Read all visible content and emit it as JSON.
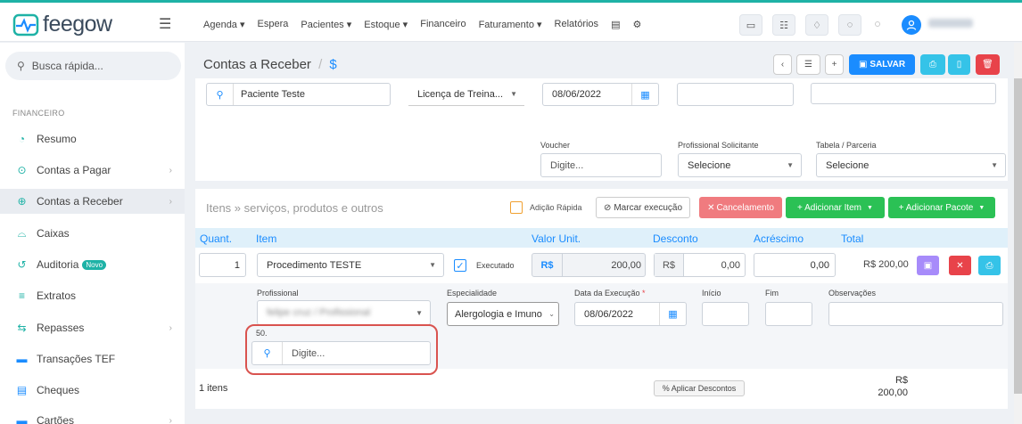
{
  "app": {
    "logo": "feegow",
    "user_name": "felipe cruz"
  },
  "topnav": {
    "items": [
      "Agenda ▾",
      "Espera",
      "Pacientes ▾",
      "Estoque ▾",
      "Financeiro",
      "Faturamento ▾",
      "Relatórios"
    ]
  },
  "sidebar": {
    "search_placeholder": "Busca rápida...",
    "section": "FINANCEIRO",
    "items": [
      {
        "label": "Resumo",
        "icon": "chart-pie-icon"
      },
      {
        "label": "Contas a Pagar",
        "icon": "arrow-circle-icon"
      },
      {
        "label": "Contas a Receber",
        "icon": "plus-circle-icon"
      },
      {
        "label": "Caixas",
        "icon": "inbox-icon"
      },
      {
        "label": "Auditoria",
        "icon": "history-icon",
        "badge": "Novo"
      },
      {
        "label": "Extratos",
        "icon": "list-icon"
      },
      {
        "label": "Repasses",
        "icon": "transfer-icon"
      },
      {
        "label": "Transações TEF",
        "icon": "card-icon"
      },
      {
        "label": "Cheques",
        "icon": "cheque-icon"
      },
      {
        "label": "Cartões",
        "icon": "card-icon"
      }
    ]
  },
  "page": {
    "title": "Contas a Receber",
    "sep": "/",
    "sub": "$",
    "save_label": "SALVAR"
  },
  "form": {
    "patient": "Paciente Teste",
    "license": "Licença de Treina...",
    "date": "08/06/2022",
    "voucher_label": "Voucher",
    "voucher_placeholder": "Digite...",
    "prof_label": "Profissional Solicitante",
    "prof_value": "Selecione",
    "table_label": "Tabela / Parceria",
    "table_value": "Selecione"
  },
  "items": {
    "title": "Itens » serviços, produtos e outros",
    "quick_add": "Adição Rápida",
    "mark_exec": "Marcar execução",
    "cancel": "Cancelamento",
    "add_item": "+ Adicionar Item",
    "add_pkg": "+ Adicionar Pacote",
    "headers": {
      "qty": "Quant.",
      "item": "Item",
      "unit": "Valor Unit.",
      "discount": "Desconto",
      "increase": "Acréscimo",
      "total": "Total"
    },
    "row": {
      "qty": "1",
      "item": "Procedimento TESTE",
      "executed": "Executado",
      "currency": "R$",
      "unit_value": "200,00",
      "disc_currency": "R$",
      "discount": "0,00",
      "increase": "0,00",
      "total": "R$ 200,00"
    },
    "detail": {
      "prof_label": "Profissional",
      "prof_value": "felipe cruz / Profissional",
      "spec_label": "Especialidade",
      "spec_value": "Alergologia e Imuno",
      "exec_label": "Data da Execução",
      "exec_value": "08/06/2022",
      "start_label": "Início",
      "end_label": "Fim",
      "obs_label": "Observações",
      "code_label": "50.",
      "code_placeholder": "Digite..."
    },
    "footer": {
      "count": "1 itens",
      "apply_discounts": "Aplicar Descontos",
      "total_currency": "R$",
      "total_value": "200,00"
    }
  },
  "colors": {
    "accent": "#1eb2a6",
    "primary": "#1a8cff",
    "green": "#2bc155",
    "red": "#e8434a",
    "highlight": "#d9534f"
  }
}
